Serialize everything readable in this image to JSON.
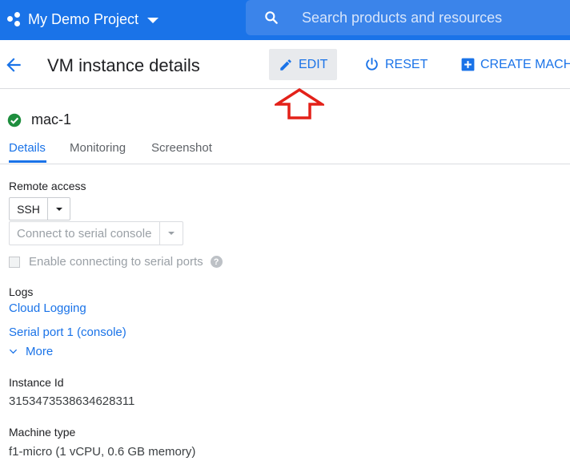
{
  "topbar": {
    "project_name": "My Demo Project",
    "search_placeholder": "Search products and resources"
  },
  "header": {
    "title": "VM instance details",
    "edit_label": "EDIT",
    "reset_label": "RESET",
    "create_label": "CREATE MACHI"
  },
  "instance": {
    "name": "mac-1"
  },
  "tabs": [
    {
      "label": "Details",
      "active": true
    },
    {
      "label": "Monitoring",
      "active": false
    },
    {
      "label": "Screenshot",
      "active": false
    }
  ],
  "remote_access": {
    "label": "Remote access",
    "ssh_label": "SSH",
    "serial_console_label": "Connect to serial console",
    "enable_serial_label": "Enable connecting to serial ports",
    "help_glyph": "?"
  },
  "logs": {
    "label": "Logs",
    "cloud_logging": "Cloud Logging",
    "serial_port": "Serial port 1 (console)",
    "more": "More"
  },
  "instance_id": {
    "label": "Instance Id",
    "value": "3153473538634628311"
  },
  "machine_type": {
    "label": "Machine type",
    "value": "f1-micro (1 vCPU, 0.6 GB memory)"
  },
  "colors": {
    "brand_blue": "#1a73e8",
    "annotation_red": "#e32119",
    "status_green": "#1e8e3e"
  },
  "icons": [
    "project-dots-icon",
    "search-icon",
    "arrow-back-icon",
    "pencil-icon",
    "power-icon",
    "add-box-icon",
    "check-circle-icon",
    "chevron-down-icon",
    "help-icon"
  ]
}
